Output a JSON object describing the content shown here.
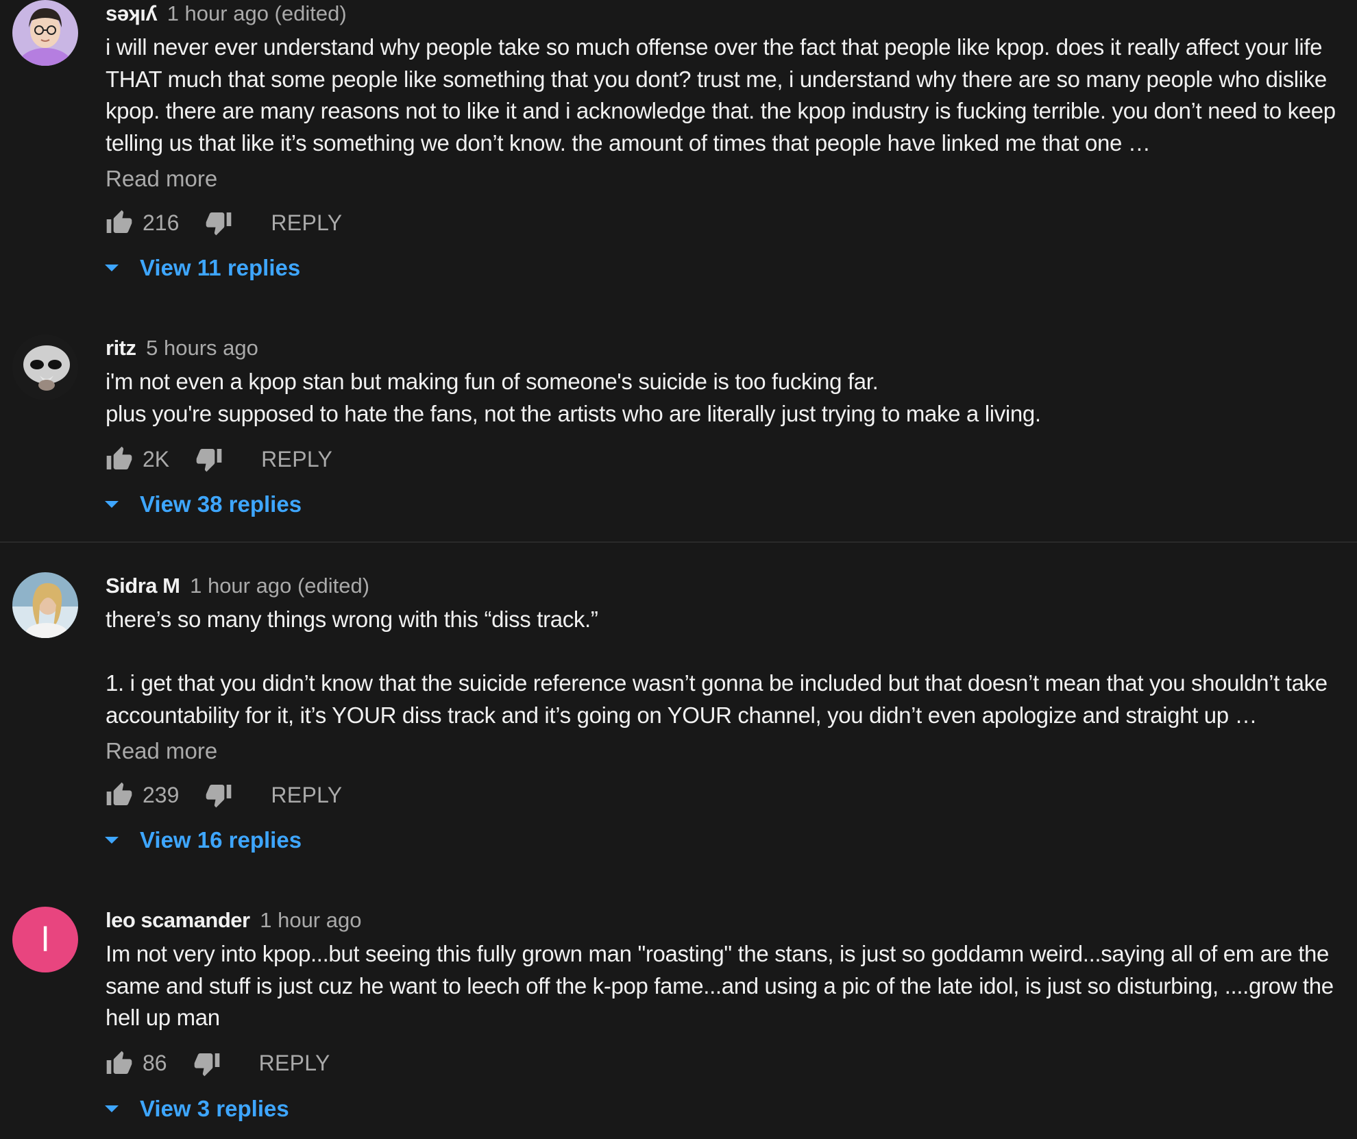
{
  "comments": [
    {
      "author": "sǝʞıʎ",
      "time": "1 hour ago (edited)",
      "text": "i will never ever understand why people take so much offense over the fact that people like kpop. does it really affect your life THAT much that some people like something that you dont? trust me, i understand why there are so many people who dislike kpop. there are many reasons not to like it and i acknowledge that. the kpop industry is fucking terrible. you don’t need to keep telling us that like it’s something we don’t know. the amount of times that people have linked me that one …",
      "read_more": "Read more",
      "likes": "216",
      "reply_label": "REPLY",
      "view_replies": "View 11 replies"
    },
    {
      "author": "ritz",
      "time": "5 hours ago",
      "text": "i'm not even a kpop stan but making fun of someone's suicide is too fucking far.\nplus you're supposed to hate the fans, not the artists who are literally just trying to make a living.",
      "likes": "2K",
      "reply_label": "REPLY",
      "view_replies": "View 38 replies"
    },
    {
      "author": "Sidra M",
      "time": "1 hour ago (edited)",
      "text": "there’s so many things wrong with this “diss track.”\n\n1. i get that you didn’t know that the suicide reference wasn’t gonna be included but that doesn’t mean that you shouldn’t take accountability for it, it’s YOUR diss track and it’s going on YOUR channel, you didn’t even apologize and straight up …",
      "read_more": "Read more",
      "likes": "239",
      "reply_label": "REPLY",
      "view_replies": "View 16 replies"
    },
    {
      "author": "leo scamander",
      "time": "1 hour ago",
      "avatar_letter": "l",
      "avatar_color": "#e8457f",
      "text": "Im not very into kpop...but seeing this fully grown man \"roasting\" the stans, is just so goddamn weird...saying all of em are the same and stuff is just cuz he want to leech off the k-pop fame...and using a pic of the late idol, is just so disturbing, ....grow the hell up man",
      "likes": "86",
      "reply_label": "REPLY",
      "view_replies": "View 3 replies"
    }
  ],
  "icons": {
    "like": "thumb-up-icon",
    "dislike": "thumb-down-icon",
    "expand": "caret-down-icon"
  },
  "colors": {
    "background": "#181818",
    "link": "#3ea6ff",
    "secondary_text": "#aaaaaa",
    "avatar_letter_bg": "#e8457f"
  }
}
